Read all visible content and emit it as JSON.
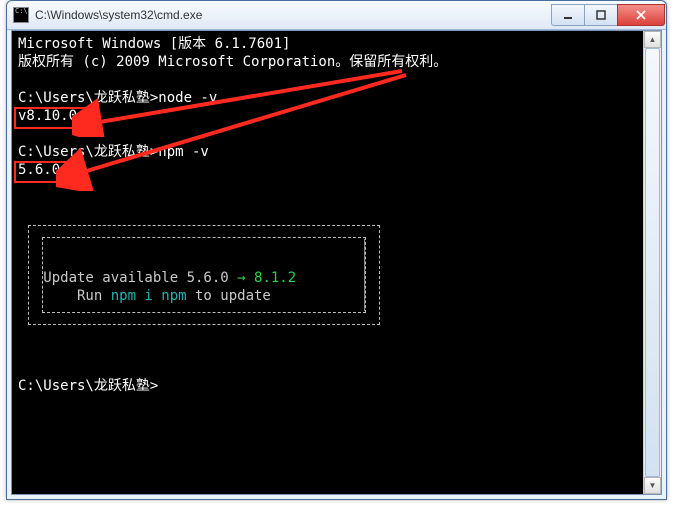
{
  "window": {
    "title": "C:\\Windows\\system32\\cmd.exe"
  },
  "term": {
    "line1": "Microsoft Windows [版本 6.1.7601]",
    "line2": "版权所有 (c) 2009 Microsoft Corporation。保留所有权利。",
    "blank": "",
    "prompt1": "C:\\Users\\龙跃私塾>node -v",
    "out1": "v8.10.0",
    "prompt2": "C:\\Users\\龙跃私塾>npm -v",
    "out2": "5.6.0",
    "update_line1_pre": "   Update available 5.6.0 ",
    "update_line1_arrow": "→",
    "update_line1_ver": " 8.1.2",
    "update_line2_pre": "       Run ",
    "update_line2_cmd": "npm i npm",
    "update_line2_post": " to update",
    "prompt3": "C:\\Users\\龙跃私塾>"
  },
  "colors": {
    "highlight": "#ff2a1f",
    "green": "#2fd14c",
    "teal": "#1fb5ac"
  }
}
